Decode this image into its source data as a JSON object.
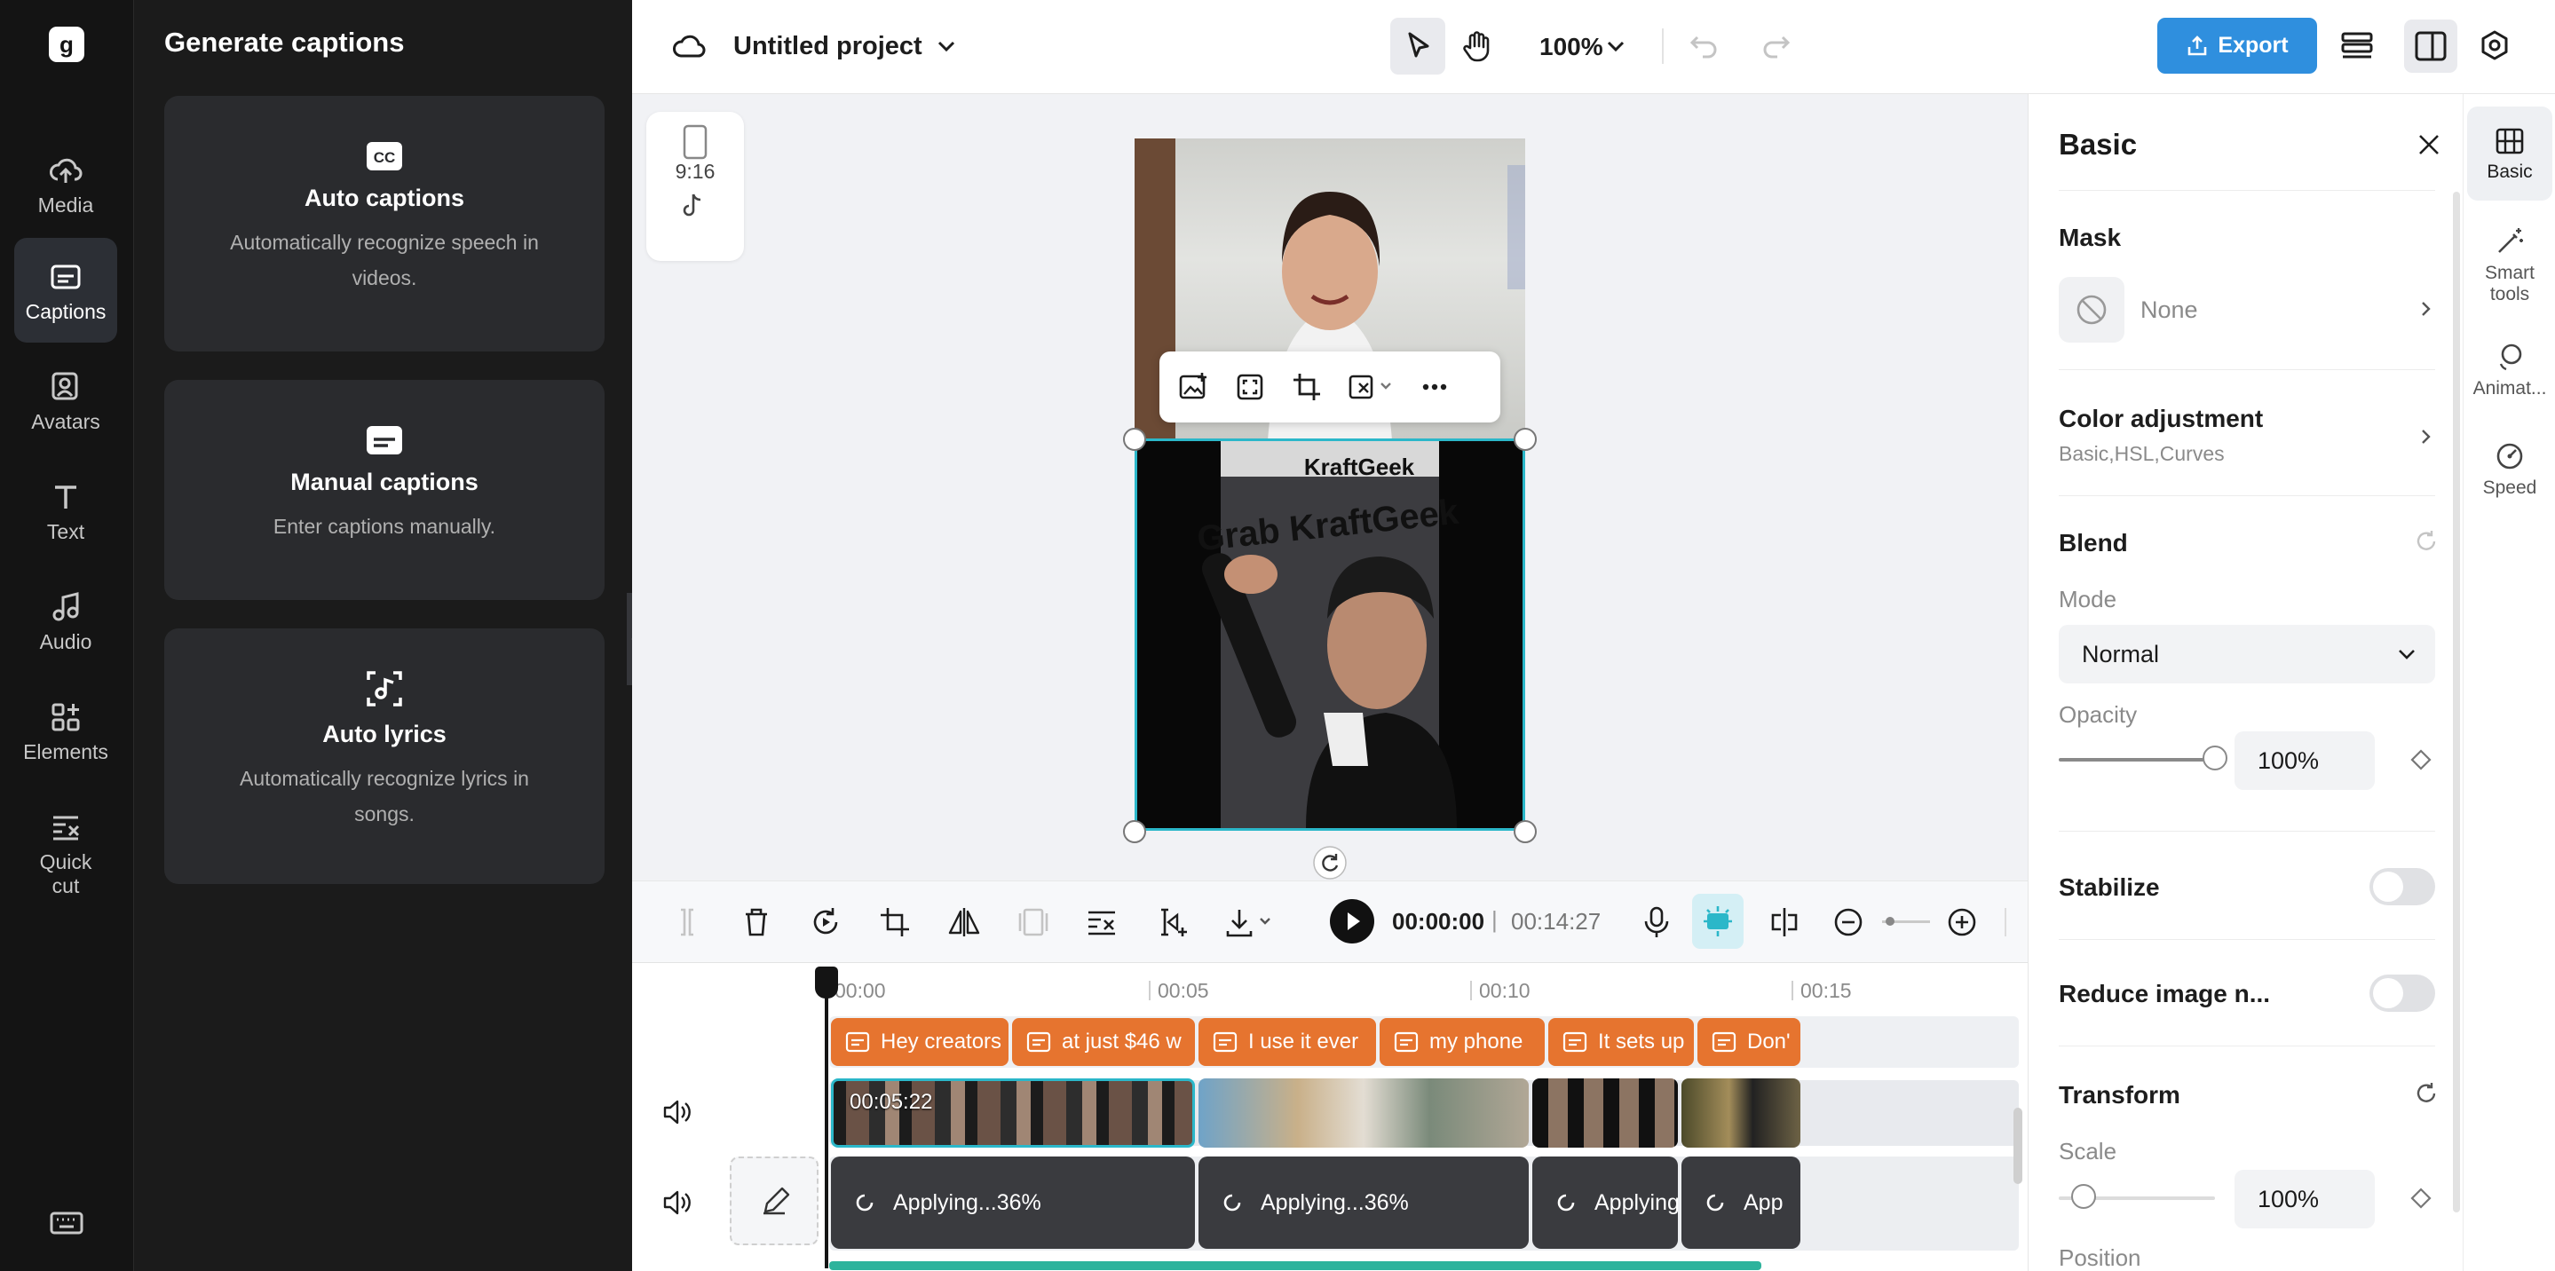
{
  "app": {
    "logo_letter": "g"
  },
  "rail": {
    "items": [
      {
        "label": "Media",
        "icon": "cloud-upload-icon"
      },
      {
        "label": "Captions",
        "icon": "captions-icon"
      },
      {
        "label": "Avatars",
        "icon": "avatar-icon"
      },
      {
        "label": "Text",
        "icon": "text-icon"
      },
      {
        "label": "Audio",
        "icon": "music-note-icon"
      },
      {
        "label": "Elements",
        "icon": "elements-icon"
      },
      {
        "label": "Quick",
        "label2": "cut",
        "icon": "quick-cut-icon"
      }
    ],
    "active": "Captions"
  },
  "captions_panel": {
    "title": "Generate captions",
    "cards": [
      {
        "title": "Auto captions",
        "desc": "Automatically recognize speech in videos.",
        "icon": "cc-icon"
      },
      {
        "title": "Manual captions",
        "desc": "Enter captions manually.",
        "icon": "subtitle-icon"
      },
      {
        "title": "Auto lyrics",
        "desc": "Automatically recognize lyrics in songs.",
        "icon": "lyrics-icon"
      }
    ]
  },
  "topbar": {
    "project_title": "Untitled project",
    "zoom": "100%",
    "export_label": "Export"
  },
  "canvas": {
    "ratio_label": "9:16",
    "video_overlay_text1": "KraftGeek",
    "video_overlay_text2": "Grab KraftGeek"
  },
  "playback": {
    "current_time": "00:00:00",
    "separator": "|",
    "total_time": "00:14:27"
  },
  "timeline": {
    "ruler": [
      "00:00",
      "00:05",
      "00:10",
      "00:15"
    ],
    "captions": [
      "Hey creators",
      "at just $46 w",
      "I use it ever",
      "my phone",
      "It sets up",
      "Don'"
    ],
    "selected_clip_time": "00:05:22",
    "applying": [
      "Applying...36%",
      "Applying...36%",
      "Applying",
      "App"
    ]
  },
  "properties": {
    "title": "Basic",
    "mask": {
      "label": "Mask",
      "value": "None"
    },
    "color_adjustment": {
      "label": "Color adjustment",
      "sub": "Basic,HSL,Curves"
    },
    "blend": {
      "label": "Blend",
      "mode_label": "Mode",
      "mode_value": "Normal",
      "opacity_label": "Opacity",
      "opacity_value": "100%",
      "opacity_level": 1.0
    },
    "stabilize": {
      "label": "Stabilize",
      "on": false
    },
    "reduce_noise": {
      "label": "Reduce image n...",
      "on": false
    },
    "transform": {
      "label": "Transform",
      "scale_label": "Scale",
      "scale_value": "100%",
      "position_label": "Position"
    }
  },
  "right_tabs": [
    {
      "label": "Basic",
      "icon": "basic-icon"
    },
    {
      "label": "Smart",
      "label2": "tools",
      "icon": "magic-wand-icon"
    },
    {
      "label": "Animat...",
      "icon": "animation-icon"
    },
    {
      "label": "Speed",
      "icon": "speed-icon"
    }
  ],
  "colors": {
    "accent": "#2f8fde",
    "caption_clip": "#e6742f",
    "selection": "#2bb7c9",
    "sidebar_bg": "#141414"
  }
}
